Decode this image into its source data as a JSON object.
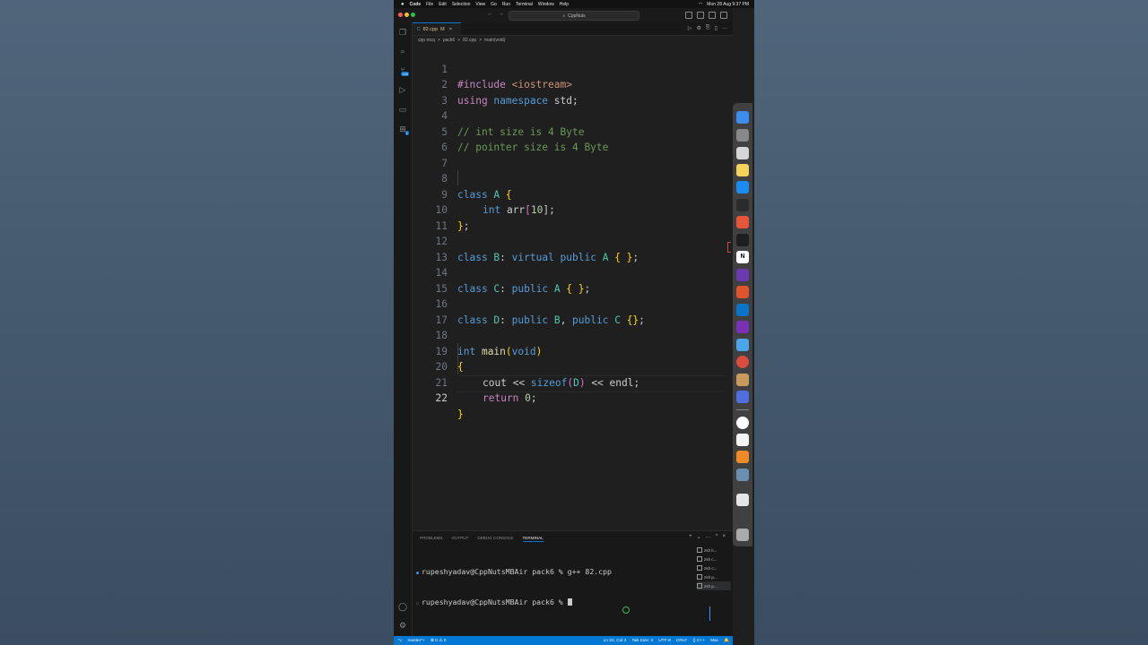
{
  "menubar": {
    "apple": "",
    "items": [
      "Code",
      "File",
      "Edit",
      "Selection",
      "View",
      "Go",
      "Run",
      "Terminal",
      "Window",
      "Help"
    ],
    "right": [
      "Mon 28 Aug 9:37 PM"
    ]
  },
  "titlebar": {
    "back": "←",
    "forward": "→",
    "search": "CppNuts"
  },
  "activity_badge": "190",
  "activity_badge2": "1",
  "tab": {
    "icon": "C",
    "name": "82.cpp",
    "modified": "M",
    "close": "×"
  },
  "tab_actions": [
    "▷",
    "⚙",
    "⎘",
    "▯",
    "…"
  ],
  "breadcrumb": [
    "cpp mcq",
    ">",
    "pack6",
    ">",
    "82.cpp",
    ">",
    "main(void)"
  ],
  "code": {
    "line_numbers": [
      "1",
      "2",
      "3",
      "4",
      "5",
      "6",
      "7",
      "8",
      "9",
      "10",
      "11",
      "12",
      "13",
      "14",
      "15",
      "16",
      "17",
      "18",
      "19",
      "20",
      "21",
      "22"
    ],
    "l1a": "#include ",
    "l1b": "<iostream>",
    "l2a": "using ",
    "l2b": "namespace ",
    "l2c": "std;",
    "l4": "// int size is 4 Byte",
    "l5": "// pointer size is 4 Byte",
    "l8a": "class ",
    "l8b": "A ",
    "l8c": "{",
    "l9a": "int ",
    "l9b": "arr",
    "l9c": "[",
    "l9d": "10",
    "l9e": "];",
    "l10a": "}",
    "l10b": ";",
    "l12a": "class ",
    "l12b": "B",
    "l12c": ": ",
    "l12d": "virtual ",
    "l12e": "public ",
    "l12f": "A ",
    "l12g": "{ }",
    "l12h": ";",
    "l14a": "class ",
    "l14b": "C",
    "l14c": ": ",
    "l14d": "public ",
    "l14e": "A ",
    "l14f": "{ }",
    "l14g": ";",
    "l16a": "class ",
    "l16b": "D",
    "l16c": ": ",
    "l16d": "public ",
    "l16e": "B",
    "l16f": ", ",
    "l16g": "public ",
    "l16h": "C ",
    "l16i": "{}",
    "l16j": ";",
    "l18a": "int ",
    "l18b": "main",
    "l18c": "(",
    "l18d": "void",
    "l18e": ")",
    "l19": "{",
    "l20a": "cout ",
    "l20b": "<< ",
    "l20c": "sizeof",
    "l20d": "(",
    "l20e": "D",
    "l20f": ")",
    "l20g": " << endl;",
    "l21a": "return ",
    "l21b": "0",
    "l21c": ";",
    "l22": "}"
  },
  "panel": {
    "tabs": [
      "PROBLEMS",
      "OUTPUT",
      "DEBUG CONSOLE",
      "TERMINAL"
    ],
    "actions": [
      "+",
      "⌄",
      "…",
      "^",
      "×"
    ],
    "terminal_lines": [
      "rupeshyadav@CppNutsMBAir pack6 % g++ 82.cpp",
      "rupeshyadav@CppNutsMBAir pack6 % "
    ],
    "term_list": [
      "zsh li...",
      "zsh c...",
      "zsh c...",
      "zsh p...",
      "zsh p..."
    ]
  },
  "status": {
    "remote": "⌥",
    "branch": "master*+",
    "problems": "⊗ 0 ⚠ 0",
    "position": "Ln 22, Col 2",
    "tab_size": "Tab Size: 4",
    "encoding": "UTF-8",
    "eol": "CRLF",
    "language": "{} C++",
    "platform": "Mac",
    "bell": "🔔"
  },
  "dock": {
    "icons": [
      "finder-icon",
      "safari-icon",
      "launchpad-icon",
      "notes-icon",
      "appstore-icon",
      "terminal-icon",
      "photos-icon",
      "terminal2-icon",
      "notion-icon",
      "finalcut-icon",
      "app-icon",
      "vscode-icon",
      "onenote-icon",
      "xcode-icon",
      "chrome-icon",
      "app2-icon",
      "app3-icon",
      "webex-icon",
      "textedit-icon",
      "sublime-icon",
      "preview-icon",
      "folder-icon",
      "trash-icon"
    ],
    "notion_letter": "N"
  }
}
